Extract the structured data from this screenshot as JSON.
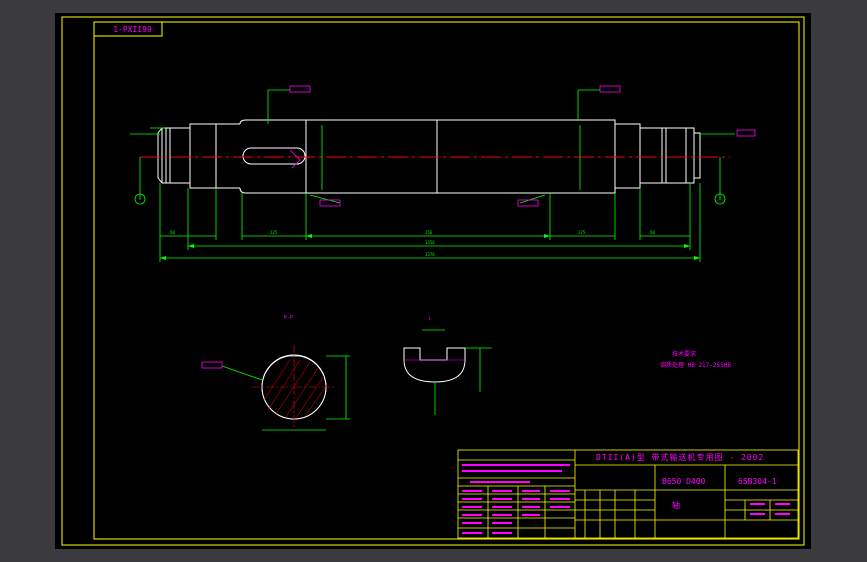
{
  "sheet": {
    "drawing_code_box": "1-PXII99"
  },
  "views": {
    "section_label": "P-P",
    "detail_label": "1-"
  },
  "notes": {
    "tech_title": "技术要求",
    "tech_line": "调质处理 HB 217-255HB"
  },
  "title_block": {
    "project": "DTII(A)型 带式输送机专用图 - 2002",
    "spec": "B650 D400",
    "drawing_no": "65B304-1",
    "part_name": "轴"
  },
  "colors": {
    "background": "#3b3b3d",
    "paper": "#000000",
    "border": "#ffff00",
    "outline": "#ffffff",
    "dimension": "#00ff00",
    "annotation": "#ff00ff",
    "centerline": "#ff0000"
  }
}
